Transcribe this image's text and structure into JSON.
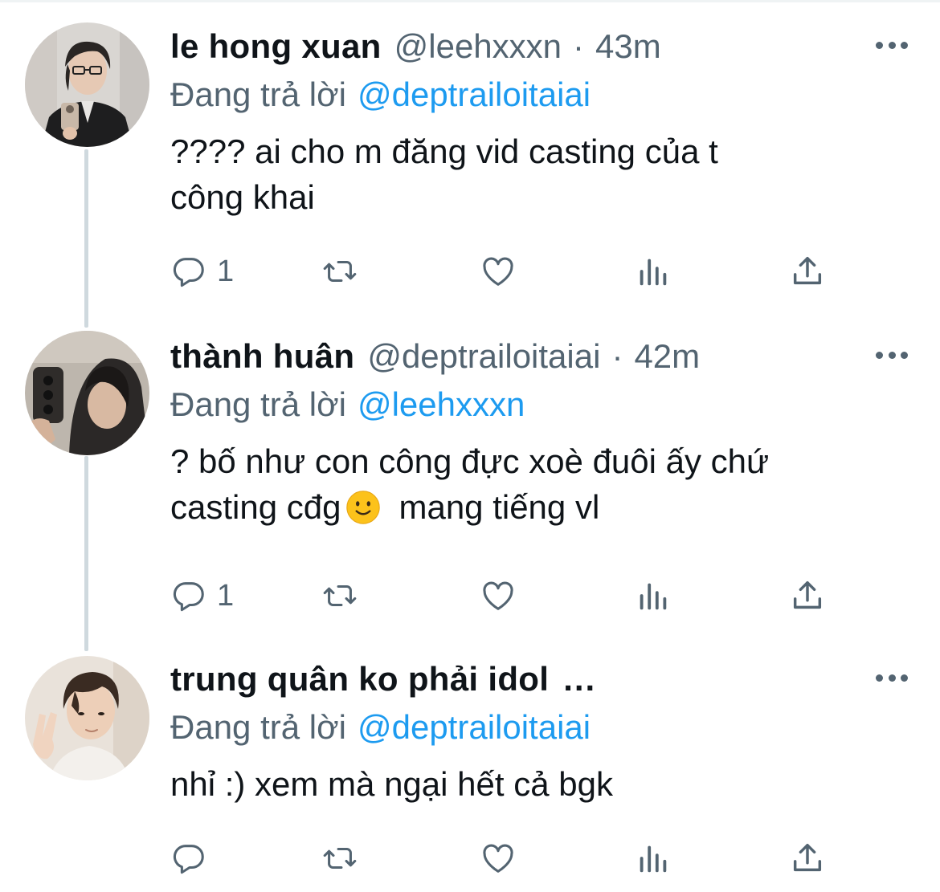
{
  "reply_prefix": "Đang trả lời",
  "more_icon": "more-horizontal-icon",
  "tweets": [
    {
      "name": "le hong xuan",
      "handle": "@leehxxxn",
      "dot": "·",
      "time": "43m",
      "reply_to": "@deptrailoitaiai",
      "text": "???? ai cho m đăng vid casting của t\ncông khai",
      "reply_count": "1"
    },
    {
      "name": "thành huân",
      "handle": "@deptrailoitaiai",
      "dot": "·",
      "time": "42m",
      "reply_to": "@leehxxxn",
      "text_line1": "? bố như con công đực xoè đuôi ấy chứ",
      "text_line2a": "casting cđg",
      "emoji": "slightly-smiling-face",
      "text_line2b": "mang tiếng vl",
      "reply_count": "1"
    },
    {
      "name": "trung quân ko phải idol",
      "name_ellipsis": "...",
      "reply_to": "@deptrailoitaiai",
      "text": "nhỉ :) xem mà ngại hết cả bgk",
      "reply_count": ""
    }
  ],
  "action_icons": [
    "reply-icon",
    "retweet-icon",
    "like-icon",
    "analytics-icon",
    "share-icon"
  ],
  "colors": {
    "link": "#1d9bf0",
    "secondary_text": "#536471",
    "primary_text": "#0f1419",
    "thread_line": "#cfd9de"
  }
}
